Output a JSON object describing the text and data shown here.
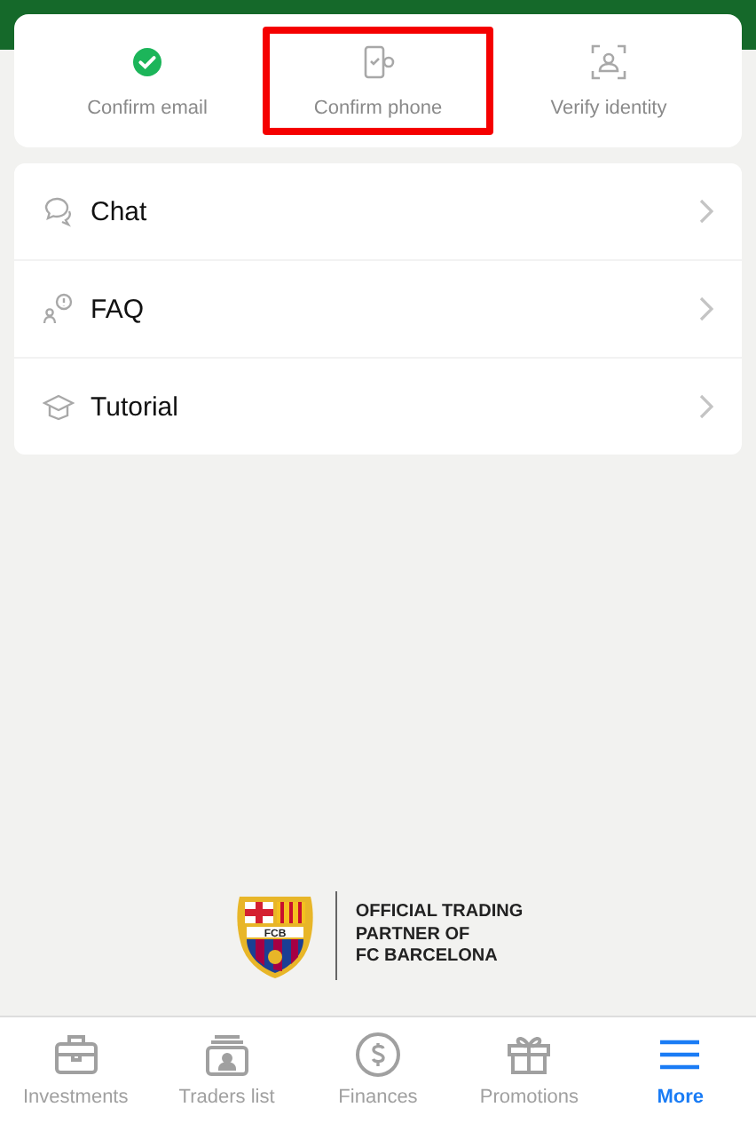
{
  "verification_steps": [
    {
      "label": "Confirm email",
      "completed": true,
      "highlighted": false
    },
    {
      "label": "Confirm phone",
      "kind": "phone",
      "completed": false,
      "highlighted": true
    },
    {
      "label": "Verify identity",
      "kind": "identity",
      "completed": false,
      "highlighted": false
    }
  ],
  "menu": [
    {
      "label": "Chat",
      "kind": "chat"
    },
    {
      "label": "FAQ",
      "kind": "faq"
    },
    {
      "label": "Tutorial",
      "kind": "tutorial"
    }
  ],
  "partner": {
    "crest_text": "FCB",
    "lines": [
      "OFFICIAL TRADING",
      "PARTNER OF",
      "FC BARCELONA"
    ]
  },
  "tab_bar": [
    {
      "label": "Investments",
      "kind": "briefcase",
      "selected": false
    },
    {
      "label": "Traders list",
      "kind": "traders",
      "selected": false
    },
    {
      "label": "Finances",
      "kind": "dollar",
      "selected": false
    },
    {
      "label": "Promotions",
      "kind": "gift",
      "selected": false
    },
    {
      "label": "More",
      "kind": "menu",
      "selected": true
    }
  ]
}
